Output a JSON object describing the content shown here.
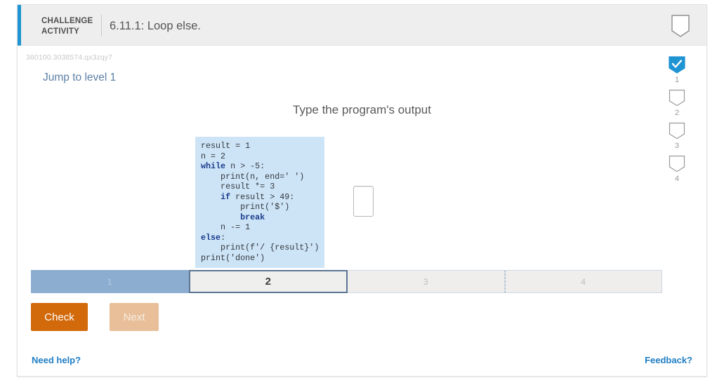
{
  "header": {
    "label": "CHALLENGE ACTIVITY",
    "title": "6.11.1: Loop else.",
    "badge_icon": "badge-outline-icon"
  },
  "body": {
    "activity_id": "360100.3038574.qx3zqy7",
    "jump_to_level": "Jump to level 1",
    "prompt": "Type the program's output"
  },
  "code": {
    "lines": [
      "result = 1",
      "n = 2",
      "while n > -5:",
      "    print(n, end=' ')",
      "    result *= 3",
      "    if result > 49:",
      "        print('$')",
      "        break",
      "    n -= 1",
      "else:",
      "    print(f'/ {result}')",
      "print('done')"
    ],
    "background": "#cde4f7",
    "keyword_color": "#1a3c8c"
  },
  "answer": {
    "value": "",
    "placeholder": ""
  },
  "progress": {
    "segments": [
      {
        "label": "1",
        "state": "done"
      },
      {
        "label": "2",
        "state": "current"
      },
      {
        "label": "3",
        "state": "todo"
      },
      {
        "label": "4",
        "state": "todo"
      }
    ]
  },
  "buttons": {
    "check": "Check",
    "next": "Next",
    "check_color": "#d2690a",
    "next_color": "#e8bf99"
  },
  "footer": {
    "need_help": "Need help?",
    "feedback": "Feedback?",
    "link_color": "#1f7ec4"
  },
  "rail": {
    "items": [
      {
        "label": "1",
        "state": "checked"
      },
      {
        "label": "2",
        "state": "empty"
      },
      {
        "label": "3",
        "state": "empty"
      },
      {
        "label": "4",
        "state": "empty"
      }
    ],
    "checked_color": "#1f94d2"
  }
}
